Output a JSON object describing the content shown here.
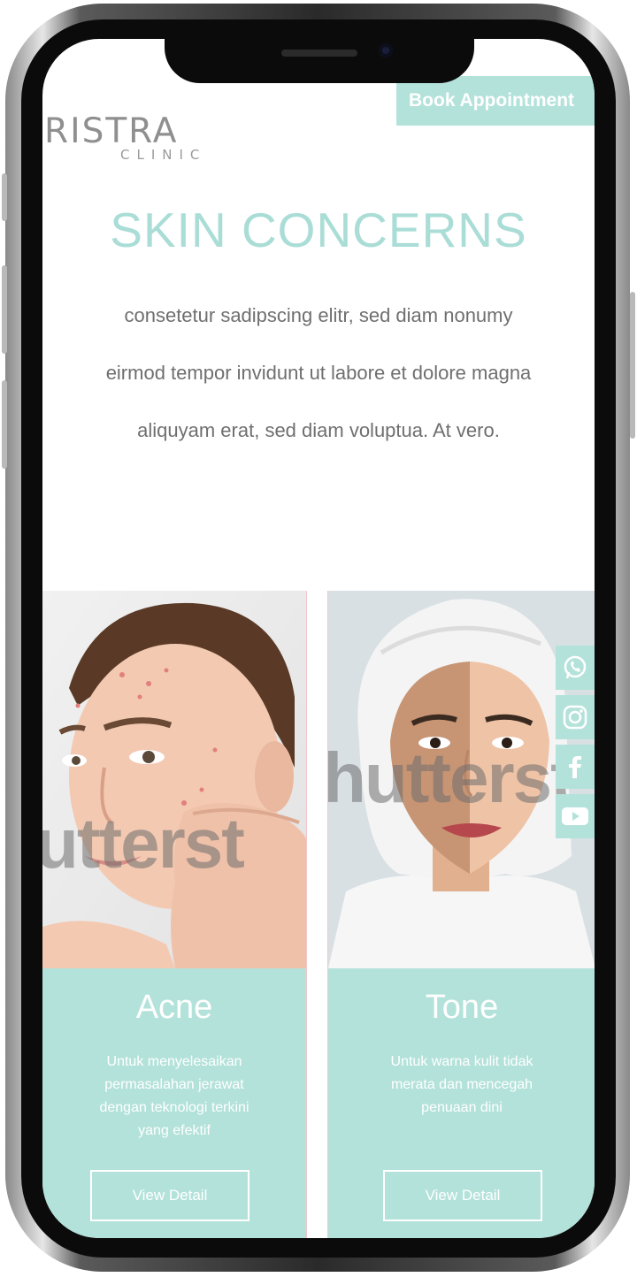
{
  "header": {
    "logo_main": "RISTRA",
    "logo_sub": "CLINIC",
    "book_button": "Book Appointment"
  },
  "section": {
    "title": "SKIN CONCERNS",
    "intro_lines": [
      "consetetur sadipscing elitr, sed diam nonumy",
      "eirmod tempor invidunt ut labore et dolore magna",
      "aliquyam erat, sed diam voluptua. At vero."
    ]
  },
  "cards": [
    {
      "title": "Acne",
      "desc_lines": [
        "Untuk menyelesaikan",
        "permasalahan jerawat",
        "dengan teknologi terkini",
        "yang efektif"
      ],
      "button": "View Detail",
      "watermark": "utterst"
    },
    {
      "title": "Tone",
      "desc_lines": [
        "Untuk warna kulit tidak",
        "merata dan mencegah",
        "penuaan dini"
      ],
      "button": "View Detail",
      "watermark": "hutterst"
    }
  ],
  "social": [
    "whatsapp-icon",
    "instagram-icon",
    "facebook-icon",
    "youtube-icon"
  ],
  "colors": {
    "accent": "#b3e2da",
    "title": "#a9ddd6",
    "text": "#6f6f6f"
  }
}
